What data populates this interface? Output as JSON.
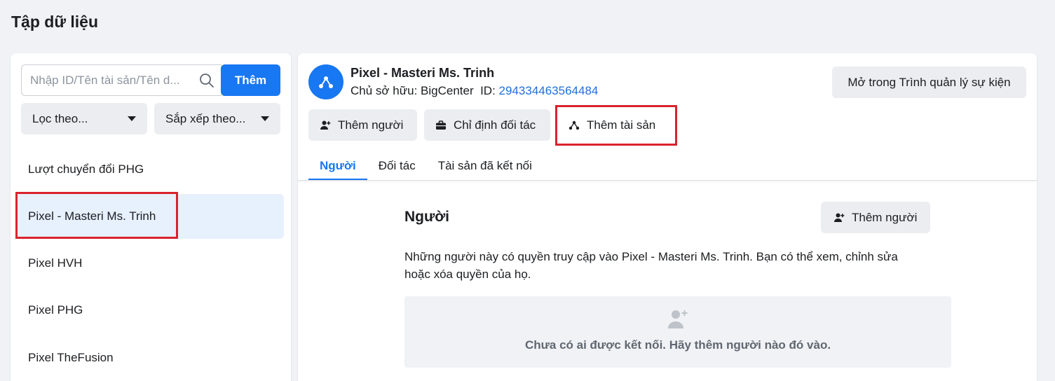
{
  "page": {
    "title": "Tập dữ liệu"
  },
  "left": {
    "search": {
      "placeholder": "Nhập ID/Tên tài sản/Tên d..."
    },
    "add_label": "Thêm",
    "filter_label": "Lọc theo...",
    "sort_label": "Sắp xếp theo...",
    "items": [
      {
        "label": "Lượt chuyển đổi PHG"
      },
      {
        "label": "Pixel - Masteri Ms. Trinh"
      },
      {
        "label": "Pixel HVH"
      },
      {
        "label": "Pixel PHG"
      },
      {
        "label": "Pixel TheFusion"
      }
    ]
  },
  "asset": {
    "name": "Pixel - Masteri Ms. Trinh",
    "owner_label": "Chủ sở hữu: BigCenter",
    "id_label": "ID:",
    "id_value": "294334463564484",
    "open_events_label": "Mở trong Trình quản lý sự kiện"
  },
  "actions": {
    "add_person": "Thêm người",
    "assign_partner": "Chỉ định đối tác",
    "add_asset": "Thêm tài sản"
  },
  "tabs": [
    {
      "label": "Người"
    },
    {
      "label": "Đối tác"
    },
    {
      "label": "Tài sản đã kết nối"
    }
  ],
  "section": {
    "title": "Người",
    "add_person": "Thêm người",
    "description": "Những người này có quyền truy cập vào Pixel - Masteri Ms. Trinh. Bạn có thể xem, chỉnh sửa hoặc xóa quyền của họ.",
    "empty_text": "Chưa có ai được kết nối. Hãy thêm người nào đó vào."
  },
  "colors": {
    "accent": "#1877f2",
    "highlight": "#d9232d",
    "selected_bg": "#e7f0fd"
  },
  "icons": {
    "search": "search-icon",
    "caret": "caret-down-icon",
    "asset": "pixel-asset-icon",
    "person_add": "person-add-icon",
    "briefcase": "briefcase-icon",
    "asset_add": "asset-nodes-icon"
  }
}
